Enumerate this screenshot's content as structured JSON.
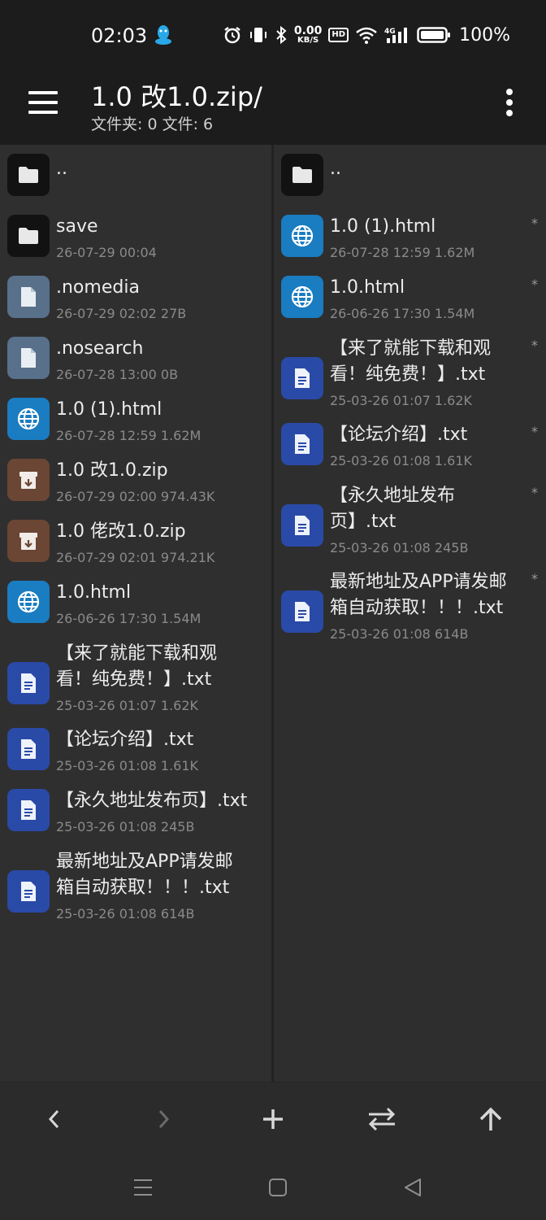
{
  "status_bar": {
    "time": "02:03",
    "speed_value": "0.00",
    "speed_unit": "KB/S",
    "hd": "HD",
    "network": "4G",
    "battery": "100%"
  },
  "app_bar": {
    "title": "1.0 改1.0.zip/",
    "subtitle": "文件夹: 0  文件: 6"
  },
  "left_pane": {
    "items": [
      {
        "name": "..",
        "meta": "",
        "icon": "folder-icon"
      },
      {
        "name": "save",
        "meta": "26-07-29 00:04",
        "icon": "folder-icon"
      },
      {
        "name": ".nomedia",
        "meta": "26-07-29 02:02  27B",
        "icon": "file-icon"
      },
      {
        "name": ".nosearch",
        "meta": "26-07-28 13:00  0B",
        "icon": "file-icon"
      },
      {
        "name": "1.0 (1).html",
        "meta": "26-07-28 12:59  1.62M",
        "icon": "globe-icon"
      },
      {
        "name": "1.0 改1.0.zip",
        "meta": "26-07-29 02:00  974.43K",
        "icon": "archive-icon"
      },
      {
        "name": "1.0 佬改1.0.zip",
        "meta": "26-07-29 02:01  974.21K",
        "icon": "archive-icon"
      },
      {
        "name": "1.0.html",
        "meta": "26-06-26 17:30  1.54M",
        "icon": "globe-icon"
      },
      {
        "name": "【来了就能下载和观",
        "name2": "看！纯免费！】.txt",
        "meta": "25-03-26 01:07  1.62K",
        "icon": "document-icon"
      },
      {
        "name": "【论坛介绍】.txt",
        "meta": "25-03-26 01:08  1.61K",
        "icon": "document-icon"
      },
      {
        "name": "【永久地址发布页】.txt",
        "meta": "25-03-26 01:08  245B",
        "icon": "document-icon"
      },
      {
        "name": "最新地址及APP请发邮",
        "name2": "箱自动获取！！！.txt",
        "meta": "25-03-26 01:08  614B",
        "icon": "document-icon"
      }
    ]
  },
  "right_pane": {
    "items": [
      {
        "name": "..",
        "meta": "",
        "icon": "folder-icon"
      },
      {
        "name": "1.0 (1).html",
        "meta": "26-07-28 12:59  1.62M",
        "icon": "globe-icon",
        "mark": "*"
      },
      {
        "name": "1.0.html",
        "meta": "26-06-26 17:30  1.54M",
        "icon": "globe-icon",
        "mark": "*"
      },
      {
        "name": "【来了就能下载和观",
        "name2": "看！纯免费！】.txt",
        "meta": "25-03-26 01:07  1.62K",
        "icon": "document-icon",
        "mark": "*"
      },
      {
        "name": "【论坛介绍】.txt",
        "meta": "25-03-26 01:08  1.61K",
        "icon": "document-icon",
        "mark": "*"
      },
      {
        "name": "【永久地址发布",
        "name2": "页】.txt",
        "meta": "25-03-26 01:08  245B",
        "icon": "document-icon",
        "mark": "*"
      },
      {
        "name": "最新地址及APP请发邮",
        "name2": "箱自动获取！！！.txt",
        "meta": "25-03-26 01:08  614B",
        "icon": "document-icon",
        "mark": "*"
      }
    ]
  },
  "toolbar": {
    "buttons": [
      "back-arrow-icon",
      "forward-arrow-icon",
      "plus-icon",
      "swap-icon",
      "up-arrow-icon"
    ]
  },
  "navigation": {
    "buttons": [
      "recents-icon",
      "home-icon",
      "back-triangle-icon"
    ]
  },
  "colors": {
    "folder": "#121212",
    "file": "#58708a",
    "web": "#1a7cc1",
    "archive": "#6b4634",
    "text_doc": "#2a4aa8"
  }
}
